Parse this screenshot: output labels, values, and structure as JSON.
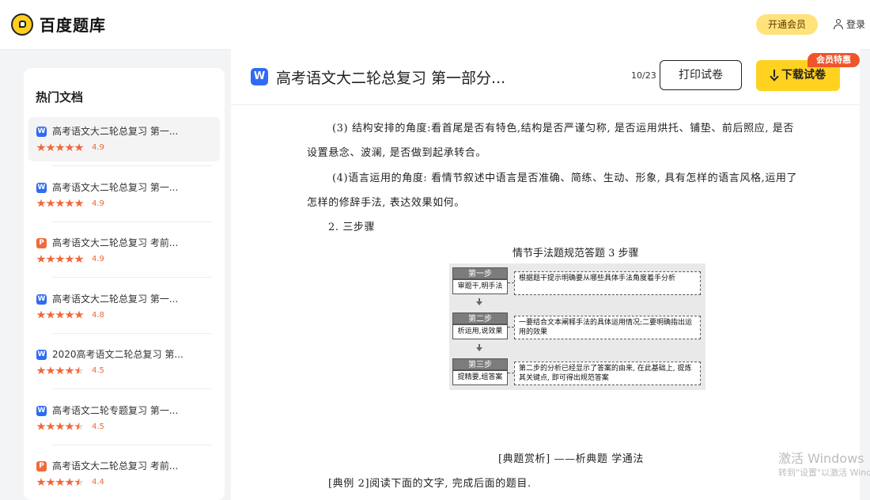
{
  "header": {
    "logo_text": "百度题库",
    "vip_label": "开通会员",
    "login_label": "登录"
  },
  "sidebar": {
    "title": "热门文档",
    "items": [
      {
        "type": "W",
        "title": "高考语文大二轮总复习 第一...",
        "rating": "4.9",
        "stars": 5.0
      },
      {
        "type": "W",
        "title": "高考语文大二轮总复习 第一...",
        "rating": "4.9",
        "stars": 5.0
      },
      {
        "type": "P",
        "title": "高考语文大二轮总复习 考前...",
        "rating": "4.9",
        "stars": 5.0
      },
      {
        "type": "W",
        "title": "高考语文大二轮总复习 第一...",
        "rating": "4.8",
        "stars": 5.0
      },
      {
        "type": "W",
        "title": "2020高考语文二轮总复习 第...",
        "rating": "4.5",
        "stars": 4.5
      },
      {
        "type": "W",
        "title": "高考语文二轮专题复习 第一...",
        "rating": "4.5",
        "stars": 4.5
      },
      {
        "type": "P",
        "title": "高考语文大二轮总复习 考前...",
        "rating": "4.4",
        "stars": 4.5
      }
    ]
  },
  "doc_header": {
    "badge": "W",
    "title": "高考语文大二轮总复习 第一部分...",
    "page_count": "10/23",
    "print_label": "打印试卷",
    "download_label": "下载试卷",
    "member_badge": "会员特惠"
  },
  "content": {
    "p1_line1": "(3) 结构安排的角度:看首尾是否有特色,结构是否严谨匀称, 是否运用烘托、铺垫、前后照应, 是否",
    "p1_line2": "设置悬念、波澜, 是否做到起承转合。",
    "p2_line1": "(4)语言运用的角度: 看情节叙述中语言是否准确、简练、生动、形象, 具有怎样的语言风格,运用了",
    "p2_line2": "怎样的修辞手法, 表达效果如何。",
    "section": "2. 三步骤",
    "figure_title": "情节手法题规范答题 3 步骤",
    "steps": [
      {
        "tag": "第一步",
        "label": "审题干,明手法",
        "desc": "根据题干提示明确要从哪些具体手法角度着手分析"
      },
      {
        "tag": "第二步",
        "label": "析运用,说效果",
        "desc": "一要结合文本阐释手法的具体运用情况;二要明确指出运用的效果"
      },
      {
        "tag": "第三步",
        "label": "提精要,组答案",
        "desc": "第二步的分析已经显示了答案的由来, 在此基础上, 提炼其关键点, 即可得出规范答案"
      }
    ],
    "example_heading": "[典题赏析] ——析典题  学通法",
    "example_intro": "[典例 2]阅读下面的文字, 完成后面的题目."
  },
  "watermark": {
    "line1": "激活 Windows",
    "line2": "转到\"设置\"以激活 Windows。"
  }
}
